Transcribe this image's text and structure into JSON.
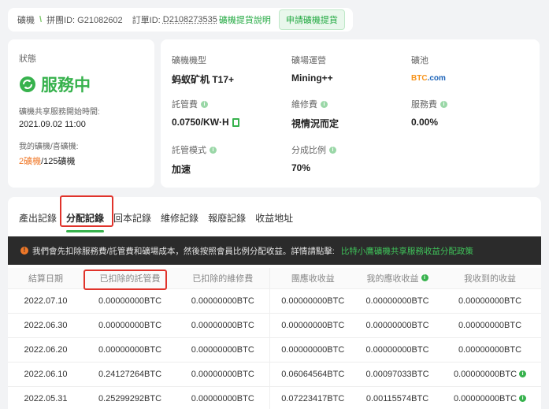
{
  "top": {
    "machine": "礦機",
    "pool_id_label": "拼團ID: G21082602",
    "order_label": "訂單ID:",
    "order_id": "D2108273535",
    "guide_link": "礦機提貨說明",
    "apply_button": "申請礦機提貨"
  },
  "status": {
    "label": "狀態",
    "value": "服務中",
    "start_label": "礦機共享服務開始時間:",
    "start_value": "2021.09.02 11:00",
    "my_machines_label": "我的礦機/喜礦機:",
    "my_count": "2礦機",
    "total_count": "/125礦機"
  },
  "info": {
    "model_label": "礦機機型",
    "model_value": "蚂蚁矿机 T17+",
    "site_label": "礦場運營",
    "site_value": "Mining++",
    "pool_label": "礦池",
    "pool_logo_a": "BTC",
    "pool_logo_b": ".com",
    "custody_label": "託管費",
    "custody_value": "0.0750/KW·H",
    "maint_label": "維修費",
    "maint_value": "視情況而定",
    "service_label": "服務費",
    "service_value": "0.00%",
    "mode_label": "託管模式",
    "mode_value": "加速",
    "share_label": "分成比例",
    "share_value": "70%"
  },
  "tabs": [
    "產出記錄",
    "分配記錄",
    "回本記錄",
    "維修記錄",
    "報廢記錄",
    "收益地址"
  ],
  "notice": {
    "text": "我們會先扣除服務費/託管費和礦場成本，然後按照會員比例分配收益。詳情請點擊:",
    "link": "比特小鷹礦機共享服務收益分配政策"
  },
  "table": {
    "headers": [
      "結算日期",
      "已扣除的託管費",
      "已扣除的維修費",
      "團應收收益",
      "我的應收收益",
      "我收到的收益"
    ],
    "rows": [
      [
        "2022.07.10",
        "0.00000000BTC",
        "0.00000000BTC",
        "0.00000000BTC",
        "0.00000000BTC",
        "0.00000000BTC"
      ],
      [
        "2022.06.30",
        "0.00000000BTC",
        "0.00000000BTC",
        "0.00000000BTC",
        "0.00000000BTC",
        "0.00000000BTC"
      ],
      [
        "2022.06.20",
        "0.00000000BTC",
        "0.00000000BTC",
        "0.00000000BTC",
        "0.00000000BTC",
        "0.00000000BTC"
      ],
      [
        "2022.06.10",
        "0.24127264BTC",
        "0.00000000BTC",
        "0.06064564BTC",
        "0.00097033BTC",
        "0.00000000BTC"
      ],
      [
        "2022.05.31",
        "0.25299292BTC",
        "0.00000000BTC",
        "0.07223417BTC",
        "0.00115574BTC",
        "0.00000000BTC"
      ]
    ]
  }
}
